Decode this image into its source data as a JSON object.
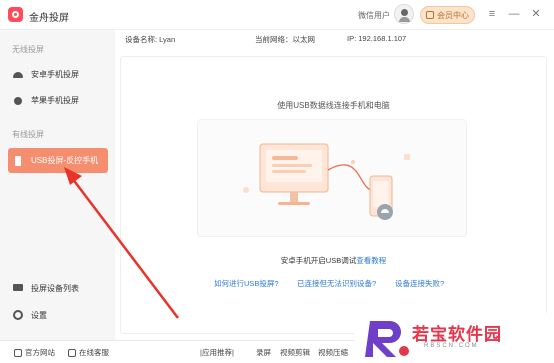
{
  "app": {
    "name": "金舟投屏"
  },
  "titlebar": {
    "user_label": "微信用户",
    "vip_label": "会员中心",
    "controls": [
      "≡",
      "—",
      "✕"
    ]
  },
  "sidebar": {
    "wireless_section": "无线投屏",
    "wired_section": "有线投屏",
    "items": [
      {
        "label": "安卓手机投屏",
        "icon": "android-icon"
      },
      {
        "label": "苹果手机投屏",
        "icon": "apple-icon"
      },
      {
        "label": "USB投屏-反控手机",
        "icon": "usb-icon",
        "active": true
      },
      {
        "label": "投屏设备列表",
        "icon": "monitor-icon"
      },
      {
        "label": "设置",
        "icon": "gear-icon"
      }
    ]
  },
  "info": {
    "device_name": "设备名称: Lyan",
    "network": "当前网络：以太网",
    "ip": "IP: 192.168.1.107"
  },
  "main": {
    "title": "使用USB数据线连接手机和电脑",
    "hint_prefix": "安卓手机开启USB调试",
    "hint_link": "查看教程",
    "links": [
      "如何进行USB投屏?",
      "已连接但无法识别设备?",
      "设备连接失败?"
    ]
  },
  "footer": {
    "items": [
      "官方网站",
      "在线客服",
      "|应用推荐|",
      "录屏",
      "视频剪辑",
      "视频压缩"
    ]
  },
  "watermark": {
    "logo_text": "若宝软件园",
    "sub": "RBSCN.COM"
  },
  "colors": {
    "accent": "#f58e6f",
    "link": "#2e7ad6",
    "arrow": "#e8332a"
  }
}
